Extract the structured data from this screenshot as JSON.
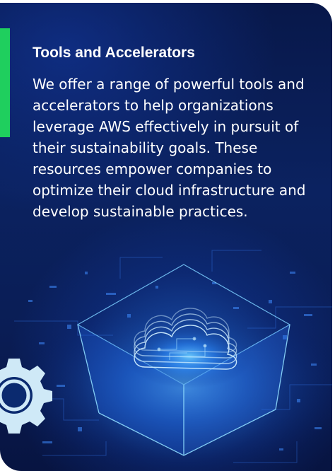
{
  "card": {
    "title": "Tools and Accelerators",
    "body": "We offer a range of powerful tools and accelerators to help organizations leverage AWS effectively in pursuit of their sustainability goals. These resources empower companies to optimize their cloud infrastructure and develop sustainable practices.",
    "accent_color": "#1fcf5e",
    "background_color": "#0b2260"
  },
  "illustration": {
    "main_icon": "cloud-icon",
    "decor_icon": "gear-icon"
  }
}
